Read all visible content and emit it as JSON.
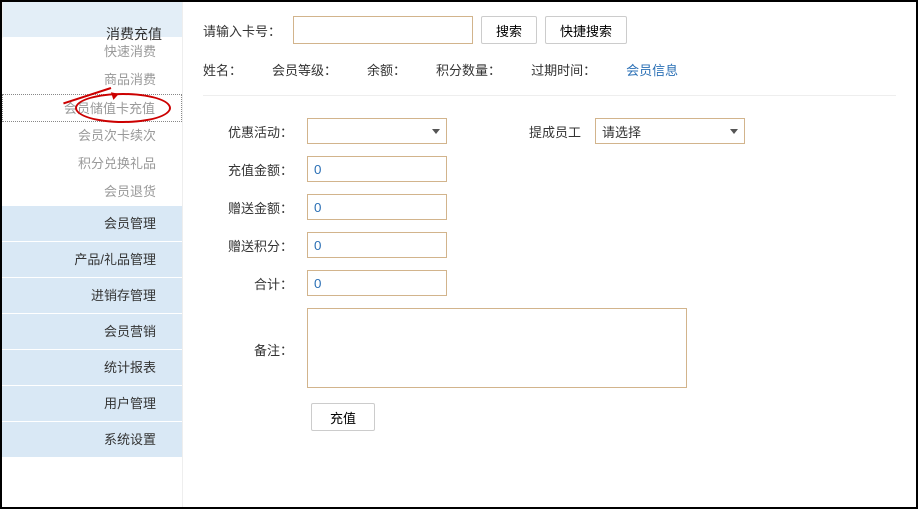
{
  "sidebar": {
    "sections": [
      {
        "name": "消费充值",
        "subs": [
          "快速消费",
          "商品消费",
          "会员储值卡充值",
          "会员次卡续次",
          "积分兑换礼品",
          "会员退货"
        ]
      },
      {
        "name": "会员管理"
      },
      {
        "name": "产品/礼品管理"
      },
      {
        "name": "进销存管理"
      },
      {
        "name": "会员营销"
      },
      {
        "name": "统计报表"
      },
      {
        "name": "用户管理"
      },
      {
        "name": "系统设置"
      }
    ]
  },
  "search": {
    "label": "请输入卡号：",
    "search_btn": "搜索",
    "quick_btn": "快捷搜索"
  },
  "info": {
    "name": "姓名：",
    "level": "会员等级：",
    "balance": "余额：",
    "points": "积分数量：",
    "expire": "过期时间：",
    "link": "会员信息"
  },
  "form": {
    "promo_label": "优惠活动：",
    "promo_value": "",
    "staff_label": "提成员工",
    "staff_value": "请选择",
    "recharge_label": "充值金额：",
    "recharge_value": "0",
    "bonus_label": "赠送金额：",
    "bonus_value": "0",
    "bonus_points_label": "赠送积分：",
    "bonus_points_value": "0",
    "total_label": "合计：",
    "total_value": "0",
    "remark_label": "备注：",
    "remark_value": "",
    "submit": "充值"
  }
}
